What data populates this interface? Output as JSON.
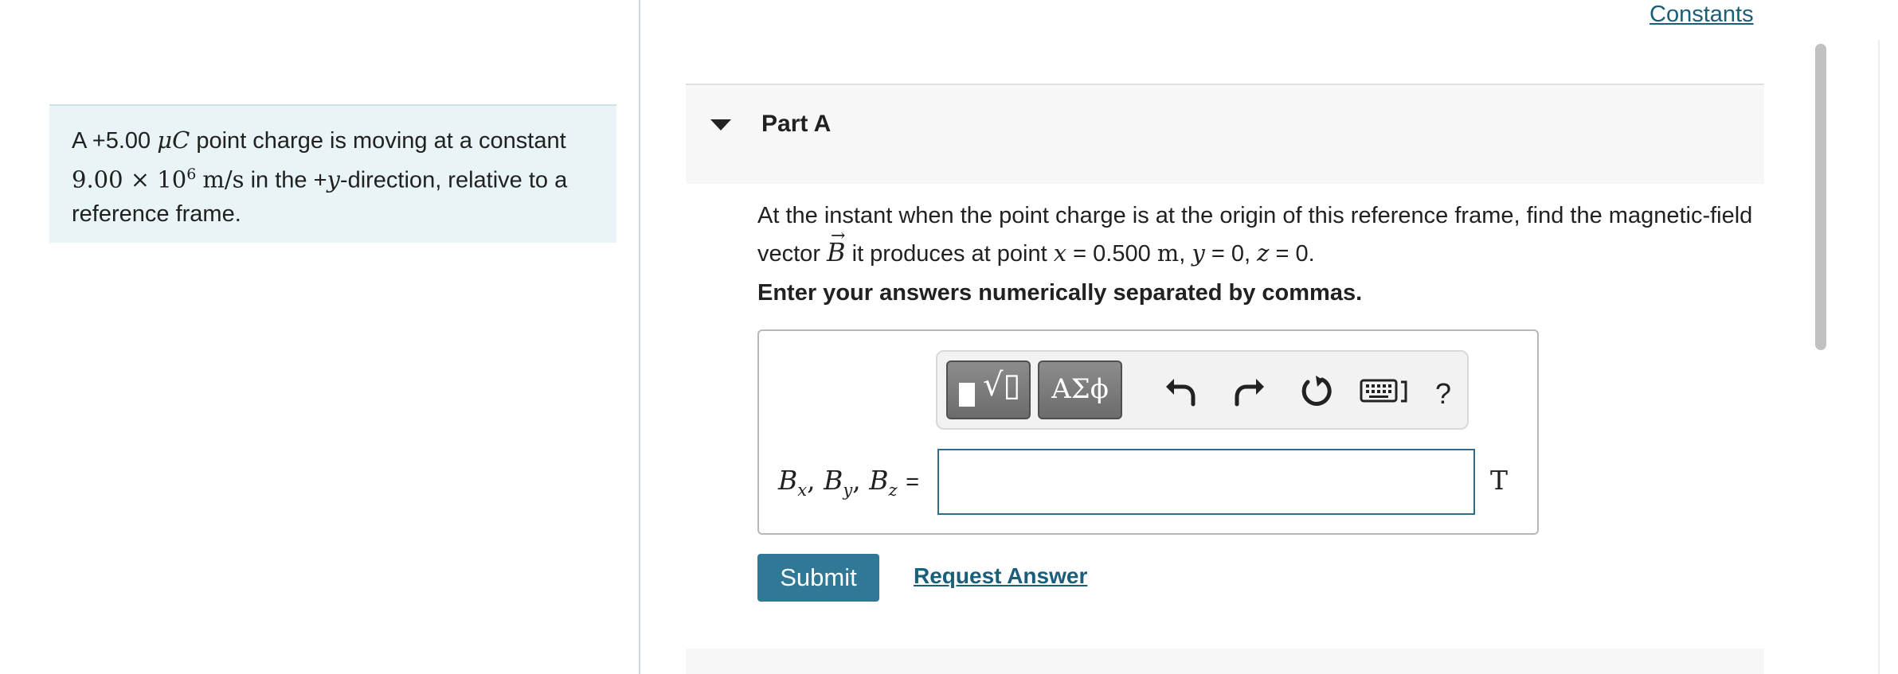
{
  "header": {
    "constants_link": "Constants"
  },
  "problem": {
    "prefix": "A +5.00",
    "charge_unit": "μC",
    "mid": "point charge is moving at a constant",
    "speed_mantissa": "9.00 × 10",
    "speed_exponent": "6",
    "speed_unit": "m/s",
    "direction_pre": "in the +",
    "direction_var": "y",
    "direction_post": "-direction, relative to a",
    "line3": "reference frame."
  },
  "part": {
    "title": "Part A",
    "expanded": true
  },
  "question": {
    "line1": "At the instant when the point charge is at the origin of this reference frame, find the magnetic-field",
    "vector_label": "vector",
    "vector_symbol": "B",
    "mid": "it produces at point",
    "x_var": "x",
    "x_eq": "= 0.500",
    "x_unit": "m",
    "y_var": "y",
    "y_eq": "= 0,",
    "z_var": "z",
    "z_eq": "= 0."
  },
  "instruction": "Enter your answers numerically separated by commas.",
  "toolbar": {
    "symbols_label": "ΑΣϕ",
    "help_label": "?",
    "icons": [
      "templates-icon",
      "greek-symbols-icon",
      "undo-icon",
      "redo-icon",
      "reset-icon",
      "keyboard-icon",
      "help-icon"
    ]
  },
  "answer": {
    "bx": "B",
    "bx_sub": "x",
    "by": "B",
    "by_sub": "y",
    "bz": "B",
    "bz_sub": "z",
    "equals": "=",
    "value": "",
    "unit": "T"
  },
  "actions": {
    "submit_label": "Submit",
    "request_answer_label": "Request Answer"
  },
  "colors": {
    "accent": "#2f7896",
    "link": "#1a5e7a",
    "problem_bg": "#e8f4f6",
    "panel_bg": "#f7f7f7"
  }
}
